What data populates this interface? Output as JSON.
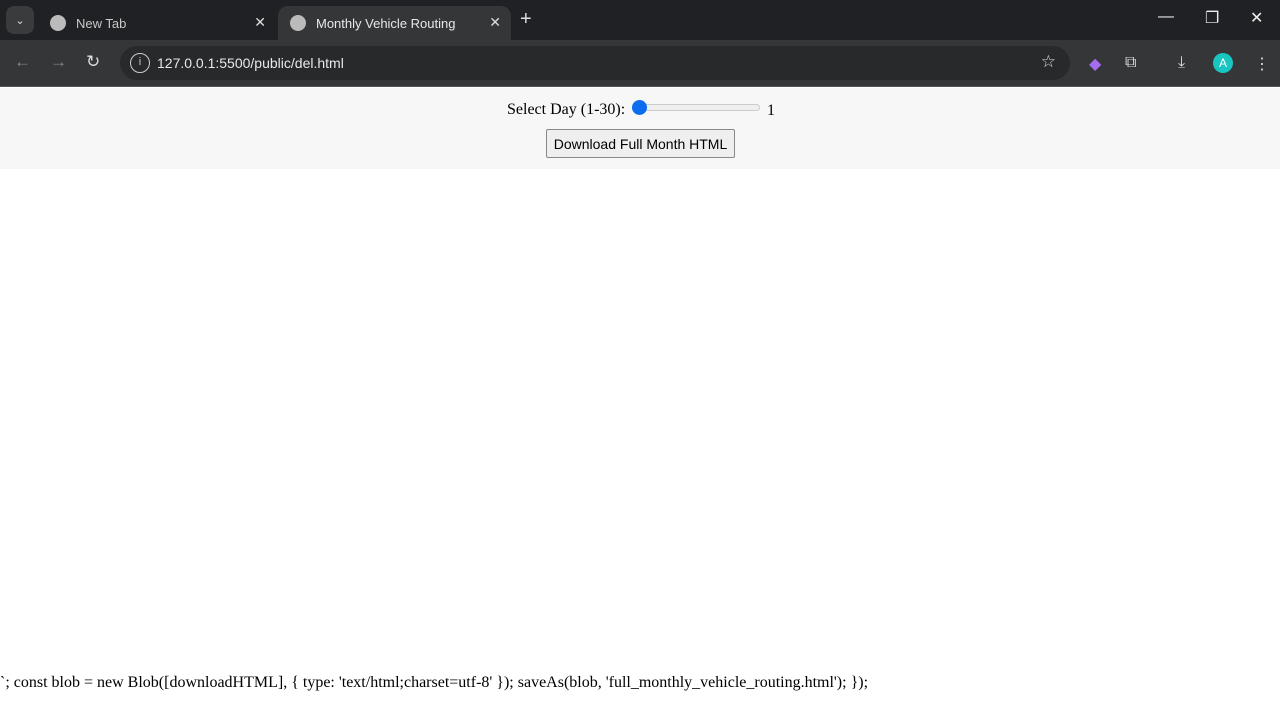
{
  "browser": {
    "tabs": [
      {
        "label": "New Tab",
        "active": false
      },
      {
        "label": "Monthly Vehicle Routing",
        "active": true
      }
    ],
    "url": "127.0.0.1:5500/public/del.html",
    "profile_initial": "A"
  },
  "page": {
    "slider_label": "Select Day (1-30):",
    "slider_min": 1,
    "slider_max": 30,
    "slider_value": "1",
    "download_button": "Download Full Month HTML",
    "code_text": "`; const blob = new Blob([downloadHTML], { type: 'text/html;charset=utf-8' }); saveAs(blob, 'full_monthly_vehicle_routing.html'); });"
  }
}
